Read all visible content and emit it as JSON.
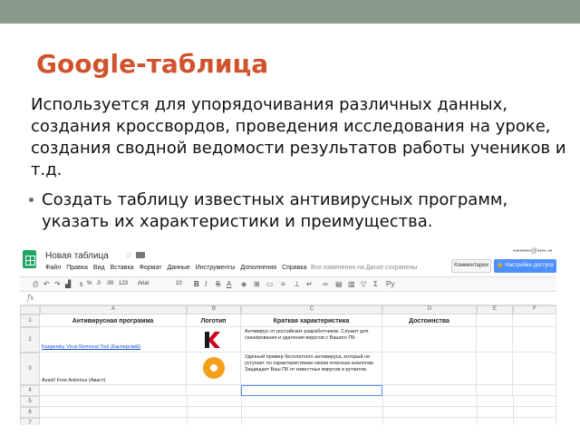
{
  "slide": {
    "title": "Google-таблица",
    "paragraph": "Используется для упорядочивания различных данных, создания кроссвордов, проведения исследования на уроке, создания сводной ведомости результатов работы учеников и т.д.",
    "bullet": "Создать таблицу известных антивирусных программ, указать их характеристики и преимущества."
  },
  "sheet": {
    "doc_title": "Новая таблица",
    "menu": [
      "Файл",
      "Правка",
      "Вид",
      "Вставка",
      "Формат",
      "Данные",
      "Инструменты",
      "Дополнения",
      "Справка"
    ],
    "save_status": "Все изменения на Диске сохранены",
    "comments_label": "Комментарии",
    "share_label": "Настройки доступа",
    "toolbar": {
      "percent": "%",
      "decimals_less": ".0",
      "decimals_more": ".00",
      "number_format": "123",
      "font": "Arial",
      "font_size": "10"
    },
    "fx_label": "fx",
    "columns": [
      "A",
      "B",
      "C",
      "D",
      "E",
      "F"
    ],
    "rows": [
      "1",
      "2",
      "3",
      "4",
      "5",
      "6",
      "7"
    ],
    "headers": {
      "a": "Антивирусная программа",
      "b": "Логотип",
      "c": "Краткая характеристика",
      "d": "Достоинства"
    },
    "row2": {
      "a": "Kaspersky Virus Removal Tool (Касперский)",
      "c": "Антивирус от российских разработчиков. Служит для сканирования и удаления вирусов с Вашего ПК."
    },
    "row3": {
      "a": "Avast! Free Antivirus (Аваст)",
      "c": "Удачный пример бесплатного антивируса, который не уступает по характеристикам своим платным аналогам. Защищает Ваш ПК от известных вирусов и руткитов."
    },
    "icons": {
      "kaspersky": "kaspersky-logo-icon",
      "avast": "avast-logo-icon"
    },
    "colors": {
      "title": "#d0532e",
      "top_bar": "#8a9a8b",
      "share_button": "#4d90fe",
      "link": "#1155cc"
    }
  }
}
